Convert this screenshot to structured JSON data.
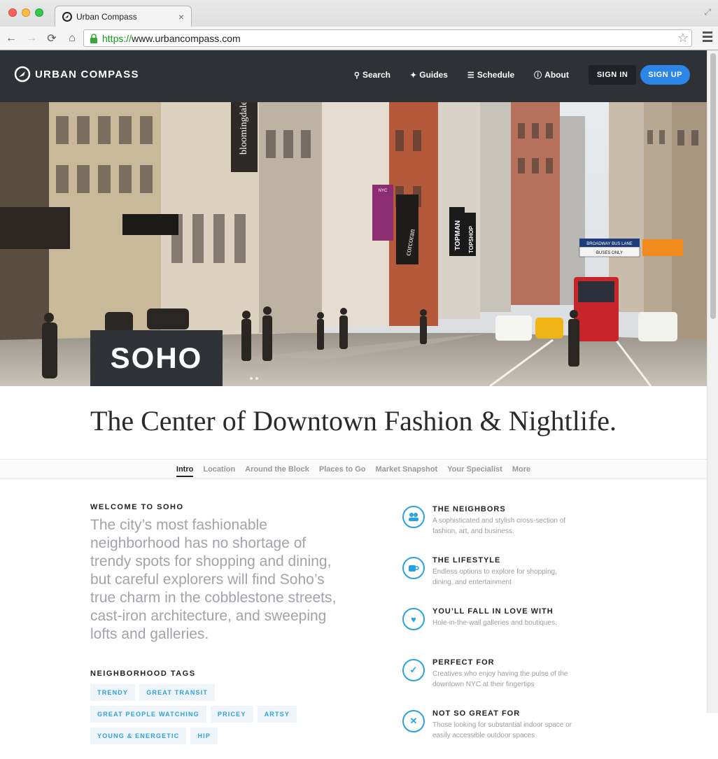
{
  "browser": {
    "tab_title": "Urban Compass",
    "tab_close": "×",
    "url_https": "https://",
    "url_rest": "www.urbancompass.com",
    "back": "←",
    "forward": "→",
    "reload": "⟳",
    "home": "⌂",
    "star": "☆"
  },
  "header": {
    "logo_text": "URBAN COMPASS",
    "nav": [
      {
        "label": "Search",
        "icon": "search-icon",
        "glyph": "⚲"
      },
      {
        "label": "Guides",
        "icon": "sparkle-icon",
        "glyph": "✦"
      },
      {
        "label": "Schedule",
        "icon": "list-icon",
        "glyph": "☰"
      },
      {
        "label": "About",
        "icon": "info-icon",
        "glyph": "ⓘ"
      }
    ],
    "sign_in": "SIGN IN",
    "sign_up": "SIGN UP"
  },
  "hero": {
    "neighborhood": "SOHO",
    "signs": {
      "bloomingdales": "bloomingdale's",
      "topman": "TOPMAN",
      "topshop": "TOPSHOP",
      "bus_lane": "BROADWAY BUS LANE",
      "bus_only": "BUSES ONLY",
      "nyc": "NYC",
      "corcoran": "corcoran"
    }
  },
  "tagline": "The Center of Downtown Fashion & Nightlife.",
  "section_tabs": [
    {
      "label": "Intro",
      "active": true
    },
    {
      "label": "Location",
      "active": false
    },
    {
      "label": "Around the Block",
      "active": false
    },
    {
      "label": "Places to Go",
      "active": false
    },
    {
      "label": "Market Snapshot",
      "active": false
    },
    {
      "label": "Your Specialist",
      "active": false
    },
    {
      "label": "More",
      "active": false
    }
  ],
  "welcome": {
    "heading": "WELCOME TO SOHO",
    "body": "The city’s most fashionable neighborhood has no shortage of trendy spots for shopping and dining, but careful explorers will find Soho’s true charm in the cobblestone streets, cast-iron architecture, and sweeping lofts and galleries."
  },
  "tags": {
    "heading": "NEIGHBORHOOD TAGS",
    "items": [
      "TRENDY",
      "GREAT TRANSIT",
      "GREAT PEOPLE WATCHING",
      "PRICEY",
      "ARTSY",
      "YOUNG & ENERGETIC",
      "HIP"
    ]
  },
  "features": [
    {
      "title": "THE NEIGHBORS",
      "desc": "A sophisticated and stylish cross-section of fashion, art, and business.",
      "icon": "people-icon",
      "glyph": "👥"
    },
    {
      "title": "THE LIFESTYLE",
      "desc": "Endless options to explore for shopping, dining, and entertainment",
      "icon": "cup-icon",
      "glyph": "☕"
    },
    {
      "title": "YOU’LL FALL IN LOVE WITH",
      "desc": "Hole-in-the-wall galleries and boutiques.",
      "icon": "heart-icon",
      "glyph": "♥"
    },
    {
      "title": "PERFECT FOR",
      "desc": "Creatives who enjoy having the pulse of the downtown NYC at their fingertips",
      "icon": "check-icon",
      "glyph": "✓"
    },
    {
      "title": "NOT SO GREAT FOR",
      "desc": "Those looking for substantial indoor space or easily accessible outdoor spaces",
      "icon": "x-icon",
      "glyph": "✕"
    }
  ]
}
